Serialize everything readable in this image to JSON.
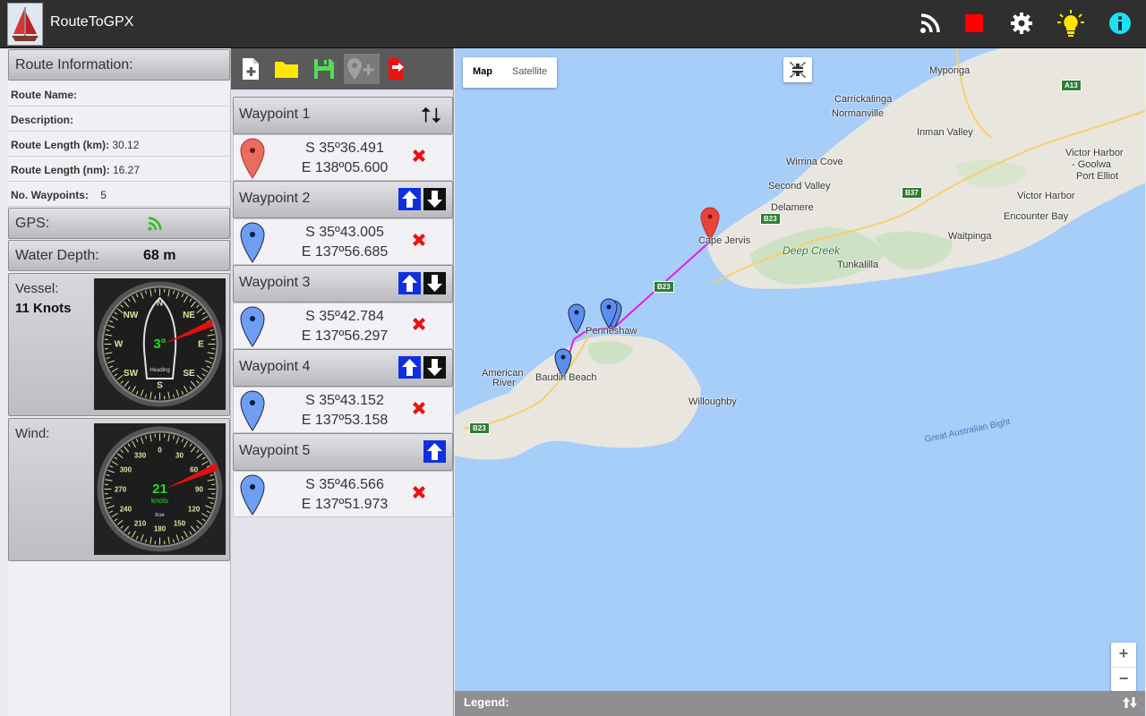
{
  "app": {
    "title": "RouteToGPX"
  },
  "toolbar": {
    "icons": [
      "rss-icon",
      "stop-icon",
      "gear-icon",
      "lightbulb-icon",
      "info-icon"
    ]
  },
  "route_info": {
    "header": "Route Information:",
    "name_label": "Route Name:",
    "name_value": "",
    "description_label": "Description:",
    "description_value": "",
    "length_km_label": "Route Length (km):",
    "length_km_value": "30.12",
    "length_nm_label": "Route Length (nm):",
    "length_nm_value": "16.27",
    "waypoints_label": "No. Waypoints:",
    "waypoints_value": "5"
  },
  "gps": {
    "label": "GPS:"
  },
  "water_depth": {
    "label": "Water Depth:",
    "value": "68 m"
  },
  "vessel": {
    "label": "Vessel:",
    "speed": "11 Knots",
    "heading": "3°",
    "heading_label": "Heading",
    "compass_labels": [
      "N",
      "NE",
      "E",
      "SE",
      "S",
      "SW",
      "W",
      "NW"
    ]
  },
  "wind": {
    "label": "Wind:",
    "speed": "21",
    "unit": "knots",
    "true_label": "true",
    "dial_labels": [
      "0",
      "30",
      "60",
      "90",
      "120",
      "150",
      "180",
      "210",
      "240",
      "270",
      "300",
      "330"
    ]
  },
  "waypoints": [
    {
      "name": "Waypoint 1",
      "lat": "S 35º36.491",
      "lon": "E 138º05.600"
    },
    {
      "name": "Waypoint 2",
      "lat": "S 35º43.005",
      "lon": "E 137º56.685"
    },
    {
      "name": "Waypoint 3",
      "lat": "S 35º42.784",
      "lon": "E 137º56.297"
    },
    {
      "name": "Waypoint 4",
      "lat": "S 35º43.152",
      "lon": "E 137º53.158"
    },
    {
      "name": "Waypoint 5",
      "lat": "S 35º46.566",
      "lon": "E 137º51.973"
    }
  ],
  "map": {
    "type_map": "Map",
    "type_satellite": "Satellite",
    "zoom_in": "+",
    "zoom_out": "−",
    "labels": {
      "myponga": "Myponga",
      "carrickalinga": "Carrickalinga",
      "normanville": "Normanville",
      "inman_valley": "Inman Valley",
      "victor_harbor_goolwa": "Victor Harbor",
      "goolwa": "- Goolwa",
      "port_elliot": "Port Elliot",
      "wirrina_cove": "Wirrina Cove",
      "second_valley": "Second Valley",
      "victor_harbor": "Victor Harbor",
      "delamere": "Delamere",
      "encounter_bay": "Encounter Bay",
      "deep_creek": "Deep Creek",
      "waitpinga": "Waitpinga",
      "cape_jervis": "Cape Jervis",
      "tunkalilla": "Tunkalilla",
      "penneshaw": "Penneshaw",
      "american_river": "American",
      "american_river_2": "River",
      "baudin_beach": "Baudin Beach",
      "willoughby": "Willoughby",
      "bight": "Great Australian Bight"
    },
    "roads": {
      "a13": "A13",
      "b37": "B37",
      "b23a": "B23",
      "b23b": "B23",
      "b23c": "B23"
    }
  },
  "legend": {
    "label": "Legend:"
  },
  "colors": {
    "route": "#e020e0",
    "pin_start": "#ea4335",
    "pin_waypoint": "#5a8ff0",
    "gps_active": "#22c022"
  }
}
